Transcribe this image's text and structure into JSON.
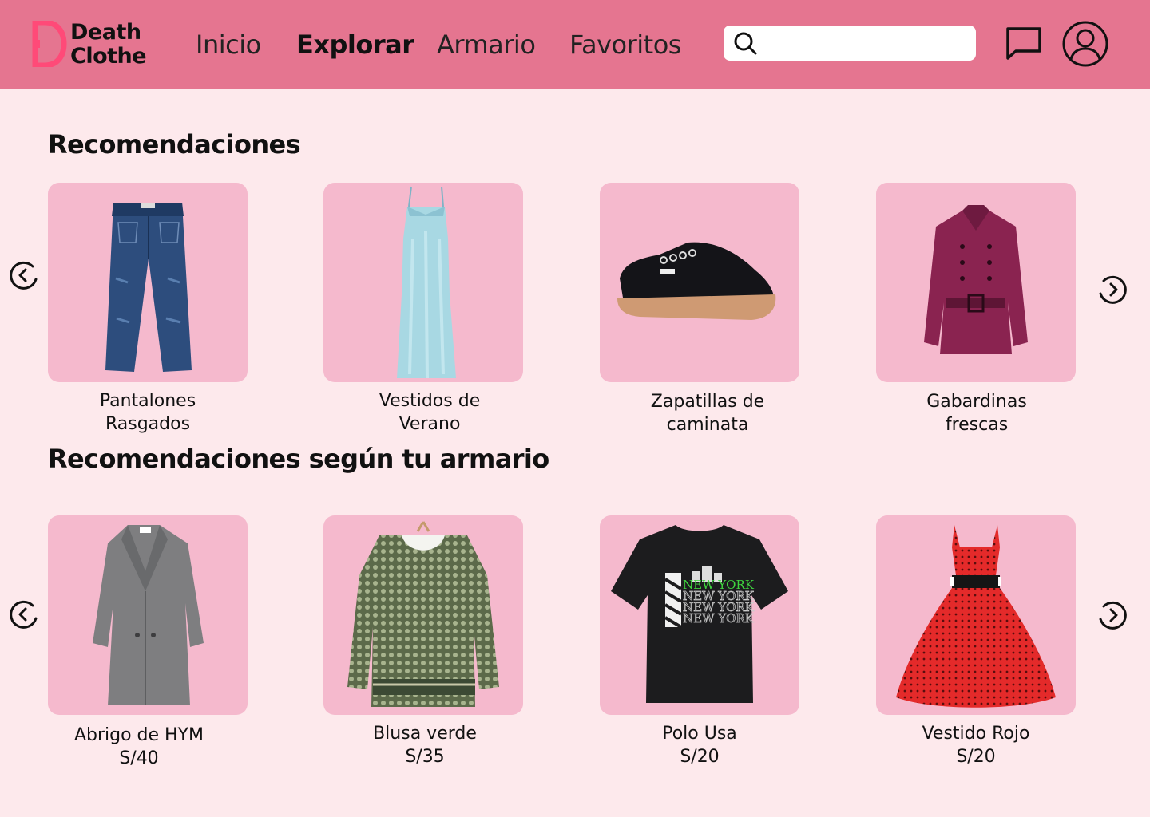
{
  "header": {
    "logo_line1": "Death",
    "logo_line2": "Clothe",
    "nav": [
      "Inicio",
      "Explorar",
      "Armario",
      "Favoritos"
    ],
    "active_nav": "Explorar",
    "search_placeholder": "",
    "accent": "#e57590"
  },
  "recommendations": {
    "title": "Recomendaciones",
    "items": [
      {
        "line1": "Pantalones",
        "line2": "Rasgados"
      },
      {
        "line1": "Vestidos de",
        "line2": "Verano"
      },
      {
        "line1": "Zapatillas de",
        "line2": "caminata"
      },
      {
        "line1": "Gabardinas",
        "line2": "frescas"
      }
    ]
  },
  "wardrobe": {
    "title": "Recomendaciones según tu armario",
    "items": [
      {
        "name": "Abrigo de HYM",
        "price": "S/40"
      },
      {
        "name": "Blusa verde",
        "price": "S/35"
      },
      {
        "name": "Polo Usa",
        "price": "S/20"
      },
      {
        "name": "Vestido Rojo",
        "price": "S/20"
      }
    ]
  },
  "product_text": {
    "tshirt_print": "NEW YORK"
  },
  "icons": {
    "logo": "death-clothe-logo-icon",
    "search": "search-icon",
    "messages": "chat-icon",
    "profile": "user-icon",
    "prev": "chevron-left-circle-icon",
    "next": "chevron-right-circle-icon"
  },
  "colors": {
    "background": "#fde9ec",
    "card": "#f5b9cd",
    "header": "#e57590",
    "logo_mark": "#ff4a78"
  }
}
